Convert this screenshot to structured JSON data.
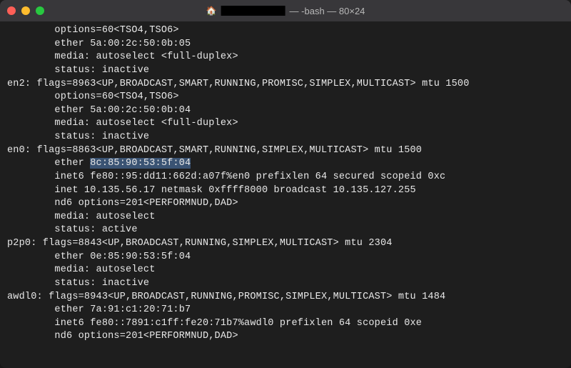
{
  "titlebar": {
    "title_suffix": " — -bash — 80×24"
  },
  "lines": [
    {
      "indent": "        ",
      "text": "options=60<TSO4,TSO6>"
    },
    {
      "indent": "        ",
      "text": "ether 5a:00:2c:50:0b:05"
    },
    {
      "indent": "        ",
      "text": "media: autoselect <full-duplex>"
    },
    {
      "indent": "        ",
      "text": "status: inactive"
    },
    {
      "indent": "",
      "text": "en2: flags=8963<UP,BROADCAST,SMART,RUNNING,PROMISC,SIMPLEX,MULTICAST> mtu 1500"
    },
    {
      "indent": "        ",
      "text": "options=60<TSO4,TSO6>"
    },
    {
      "indent": "        ",
      "text": "ether 5a:00:2c:50:0b:04"
    },
    {
      "indent": "        ",
      "text": "media: autoselect <full-duplex>"
    },
    {
      "indent": "        ",
      "text": "status: inactive"
    },
    {
      "indent": "",
      "text": "en0: flags=8863<UP,BROADCAST,SMART,RUNNING,SIMPLEX,MULTICAST> mtu 1500"
    },
    {
      "indent": "        ",
      "prefix": "ether ",
      "highlighted": "8c:85:90:53:5f:04",
      "suffix": ""
    },
    {
      "indent": "        ",
      "text": "inet6 fe80::95:dd11:662d:a07f%en0 prefixlen 64 secured scopeid 0xc"
    },
    {
      "indent": "        ",
      "text": "inet 10.135.56.17 netmask 0xffff8000 broadcast 10.135.127.255"
    },
    {
      "indent": "        ",
      "text": "nd6 options=201<PERFORMNUD,DAD>"
    },
    {
      "indent": "        ",
      "text": "media: autoselect"
    },
    {
      "indent": "        ",
      "text": "status: active"
    },
    {
      "indent": "",
      "text": "p2p0: flags=8843<UP,BROADCAST,RUNNING,SIMPLEX,MULTICAST> mtu 2304"
    },
    {
      "indent": "        ",
      "text": "ether 0e:85:90:53:5f:04"
    },
    {
      "indent": "        ",
      "text": "media: autoselect"
    },
    {
      "indent": "        ",
      "text": "status: inactive"
    },
    {
      "indent": "",
      "text": "awdl0: flags=8943<UP,BROADCAST,RUNNING,PROMISC,SIMPLEX,MULTICAST> mtu 1484"
    },
    {
      "indent": "        ",
      "text": "ether 7a:91:c1:20:71:b7"
    },
    {
      "indent": "        ",
      "text": "inet6 fe80::7891:c1ff:fe20:71b7%awdl0 prefixlen 64 scopeid 0xe"
    },
    {
      "indent": "        ",
      "text": "nd6 options=201<PERFORMNUD,DAD>"
    }
  ]
}
